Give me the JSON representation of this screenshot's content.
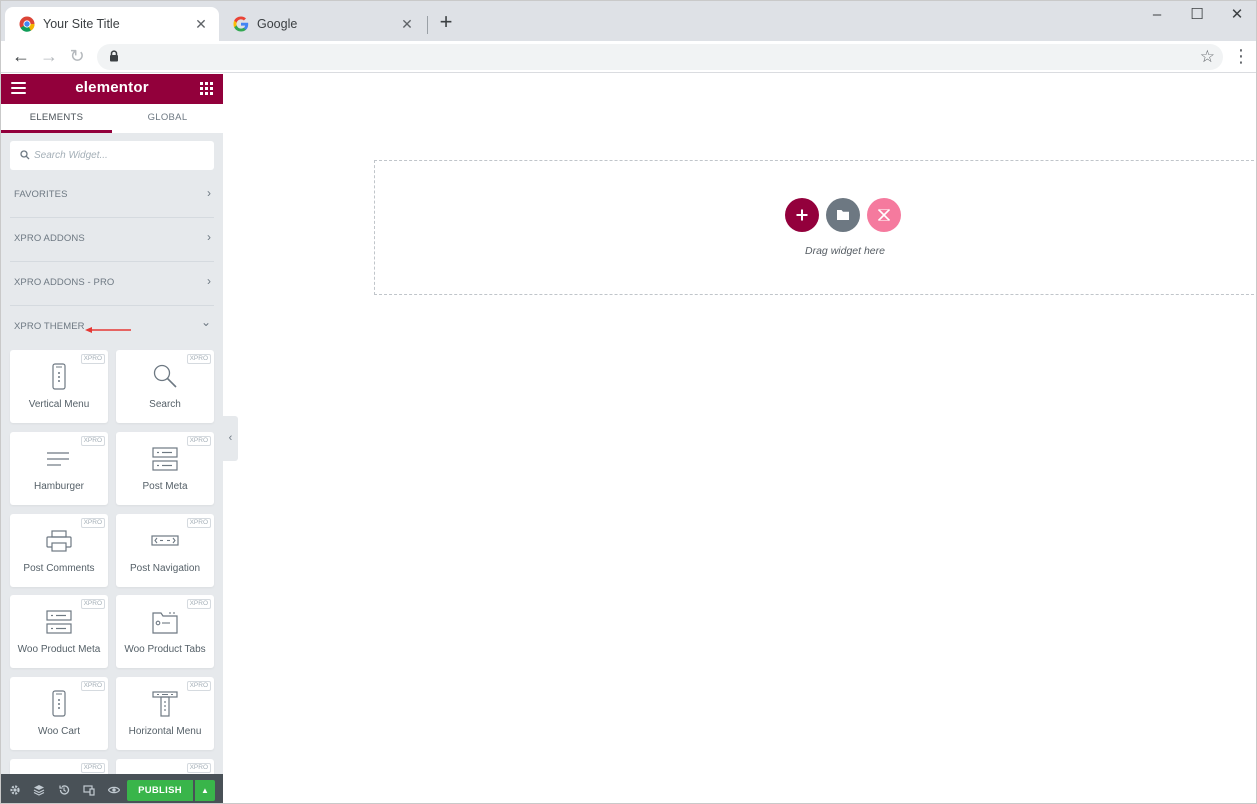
{
  "browser": {
    "tabs": [
      {
        "title": "Your Site Title",
        "active": true
      },
      {
        "title": "Google",
        "active": false
      }
    ],
    "new_tab_label": "+",
    "window_controls": {
      "minimize": "–",
      "maximize": "☐",
      "close": "✕"
    },
    "nav": {
      "back": "←",
      "forward": "→",
      "reload": "↻"
    },
    "star": "☆",
    "menu": "⋮"
  },
  "panel": {
    "brand": "elementor",
    "brand_color": "#92003b",
    "tabs": [
      "ELEMENTS",
      "GLOBAL"
    ],
    "search": {
      "placeholder": "Search Widget..."
    },
    "categories": [
      {
        "label": "FAVORITES",
        "chevron": "›"
      },
      {
        "label": "XPRO ADDONS",
        "chevron": "›"
      },
      {
        "label": "XPRO ADDONS - PRO",
        "chevron": "›"
      },
      {
        "label": "XPRO THEMER",
        "chevron": "⌄"
      }
    ],
    "badge": "XPRO",
    "widgets": [
      {
        "label": "Vertical Menu",
        "icon": "phone-icon"
      },
      {
        "label": "Search",
        "icon": "search-icon"
      },
      {
        "label": "Hamburger",
        "icon": "hamburger-icon"
      },
      {
        "label": "Post Meta",
        "icon": "post-meta-icon"
      },
      {
        "label": "Post Comments",
        "icon": "printer-icon"
      },
      {
        "label": "Post Navigation",
        "icon": "navigation-icon"
      },
      {
        "label": "Woo Product Meta",
        "icon": "product-meta-icon"
      },
      {
        "label": "Woo Product Tabs",
        "icon": "folder-tabs-icon"
      },
      {
        "label": "Woo Cart",
        "icon": "phone-icon"
      },
      {
        "label": "Horizontal Menu",
        "icon": "horizontal-menu-icon"
      }
    ],
    "footer": {
      "publish": "PUBLISH",
      "publish_color": "#39b54a"
    },
    "collapse": "‹"
  },
  "canvas": {
    "drag_text": "Drag widget here",
    "buttons": {
      "add": "+"
    }
  }
}
